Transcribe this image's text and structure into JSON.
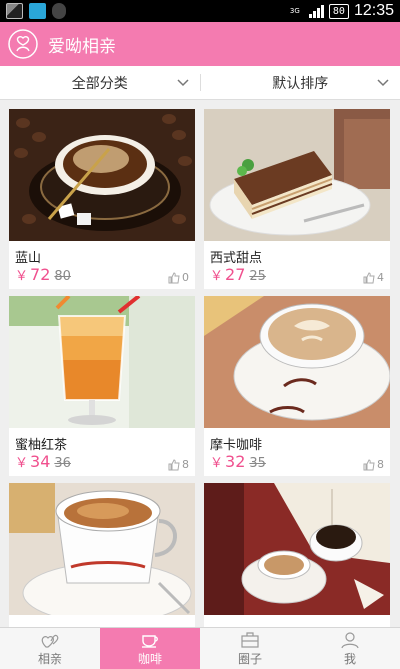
{
  "status_bar": {
    "left_icons": [
      "sd-card-icon",
      "qq-icon",
      "app-notification-icon"
    ],
    "network": "3G",
    "battery": "80",
    "time": "12:35"
  },
  "app": {
    "title": "爱呦相亲",
    "accent_color": "#f47bb0",
    "price_color": "#f0508e"
  },
  "filters": {
    "category_label": "全部分类",
    "sort_label": "默认排序"
  },
  "currency_symbol": "￥",
  "products": [
    {
      "name": "蓝山",
      "price": "72",
      "original_price": "80",
      "likes": "0"
    },
    {
      "name": "西式甜点",
      "price": "27",
      "original_price": "25",
      "likes": "4"
    },
    {
      "name": "蜜柚红茶",
      "price": "34",
      "original_price": "36",
      "likes": "8"
    },
    {
      "name": "摩卡咖啡",
      "price": "32",
      "original_price": "35",
      "likes": "8"
    },
    {
      "name": "",
      "price": "",
      "original_price": "",
      "likes": ""
    },
    {
      "name": "",
      "price": "",
      "original_price": "",
      "likes": ""
    }
  ],
  "bottom_nav": {
    "tabs": [
      {
        "label": "相亲",
        "icon": "hearts-icon",
        "active": false
      },
      {
        "label": "咖啡",
        "icon": "coffee-cup-icon",
        "active": true
      },
      {
        "label": "圈子",
        "icon": "briefcase-icon",
        "active": false
      },
      {
        "label": "我",
        "icon": "person-icon",
        "active": false
      }
    ]
  }
}
